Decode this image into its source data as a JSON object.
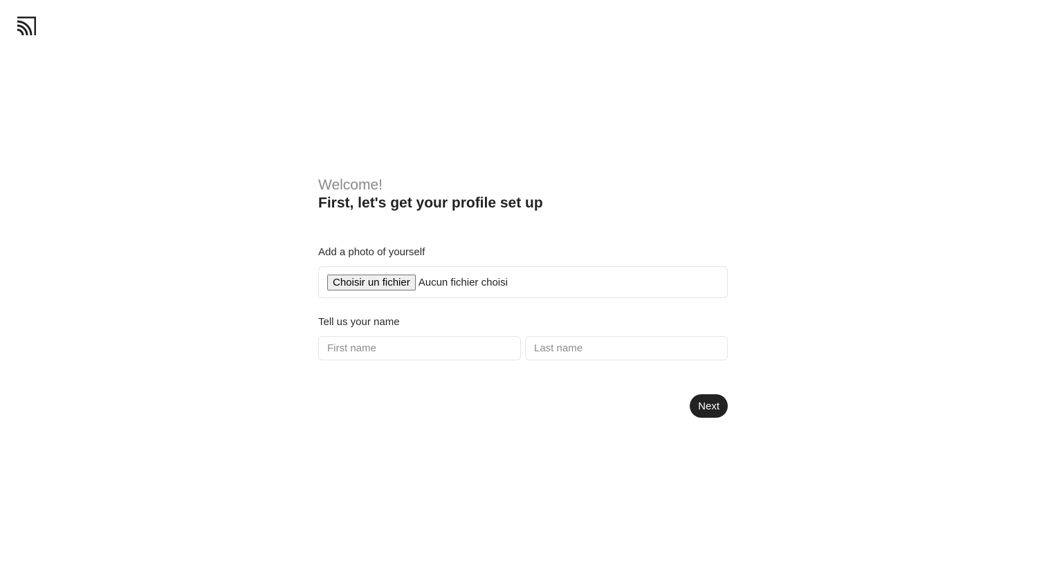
{
  "header": {
    "logo_icon": "brand-logo-icon"
  },
  "intro": {
    "welcome": "Welcome!",
    "title": "First, let's get your profile set up"
  },
  "photo": {
    "label": "Add a photo of yourself",
    "button_label": "Choisir un fichier",
    "status": "Aucun fichier choisi"
  },
  "name": {
    "label": "Tell us your name",
    "first_name_placeholder": "First name",
    "last_name_placeholder": "Last name"
  },
  "actions": {
    "next_label": "Next"
  },
  "colors": {
    "primary_button": "#222222",
    "muted_text": "#8a8a8a",
    "border": "#e6e6e6"
  }
}
